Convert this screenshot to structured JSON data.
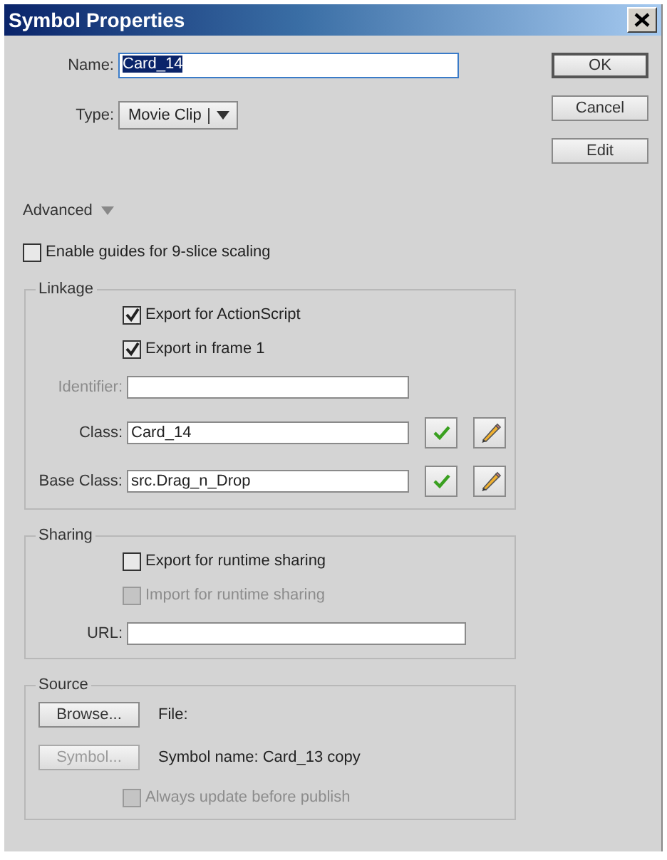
{
  "window": {
    "title": "Symbol Properties"
  },
  "name_field": {
    "label": "Name:",
    "value": "Card_14",
    "text_selected": true
  },
  "type_dropdown": {
    "label": "Type:",
    "value": "Movie Clip"
  },
  "buttons": [
    {
      "label": "OK",
      "default": true
    },
    {
      "label": "Cancel",
      "default": false
    },
    {
      "label": "Edit",
      "default": false
    }
  ],
  "advanced": {
    "label": "Advanced"
  },
  "slice_guides": {
    "label": "Enable guides for 9-slice scaling",
    "checked": false,
    "disabled": false
  },
  "groups": [
    {
      "title": "Linkage",
      "rows": [
        {
          "kind": "checkbox",
          "label": "Export for ActionScript",
          "checked": true,
          "disabled": false
        },
        {
          "kind": "checkbox",
          "label": "Export in frame 1",
          "checked": true,
          "disabled": false
        },
        {
          "kind": "field",
          "label": "Identifier:",
          "value": "",
          "disabled": true
        },
        {
          "kind": "class_field",
          "label": "Class:",
          "value": "Card_14",
          "disabled": false
        },
        {
          "kind": "class_field",
          "label": "Base Class:",
          "value": "src.Drag_n_Drop",
          "disabled": false
        }
      ]
    },
    {
      "title": "Sharing",
      "rows": [
        {
          "kind": "checkbox",
          "label": "Export for runtime sharing",
          "checked": false,
          "disabled": false
        },
        {
          "kind": "checkbox",
          "label": "Import for runtime sharing",
          "checked": false,
          "disabled": true
        },
        {
          "kind": "wide_field",
          "label": "URL:",
          "value": "",
          "disabled": false
        }
      ]
    },
    {
      "title": "Source",
      "rows": [
        {
          "kind": "button_text",
          "button": "Browse...",
          "text": "File:",
          "disabled": false
        },
        {
          "kind": "button_text",
          "button": "Symbol...",
          "text": "Symbol name: Card_13 copy",
          "disabled": true
        },
        {
          "kind": "checkbox",
          "label": "Always update before publish",
          "checked": false,
          "disabled": true
        }
      ]
    }
  ]
}
